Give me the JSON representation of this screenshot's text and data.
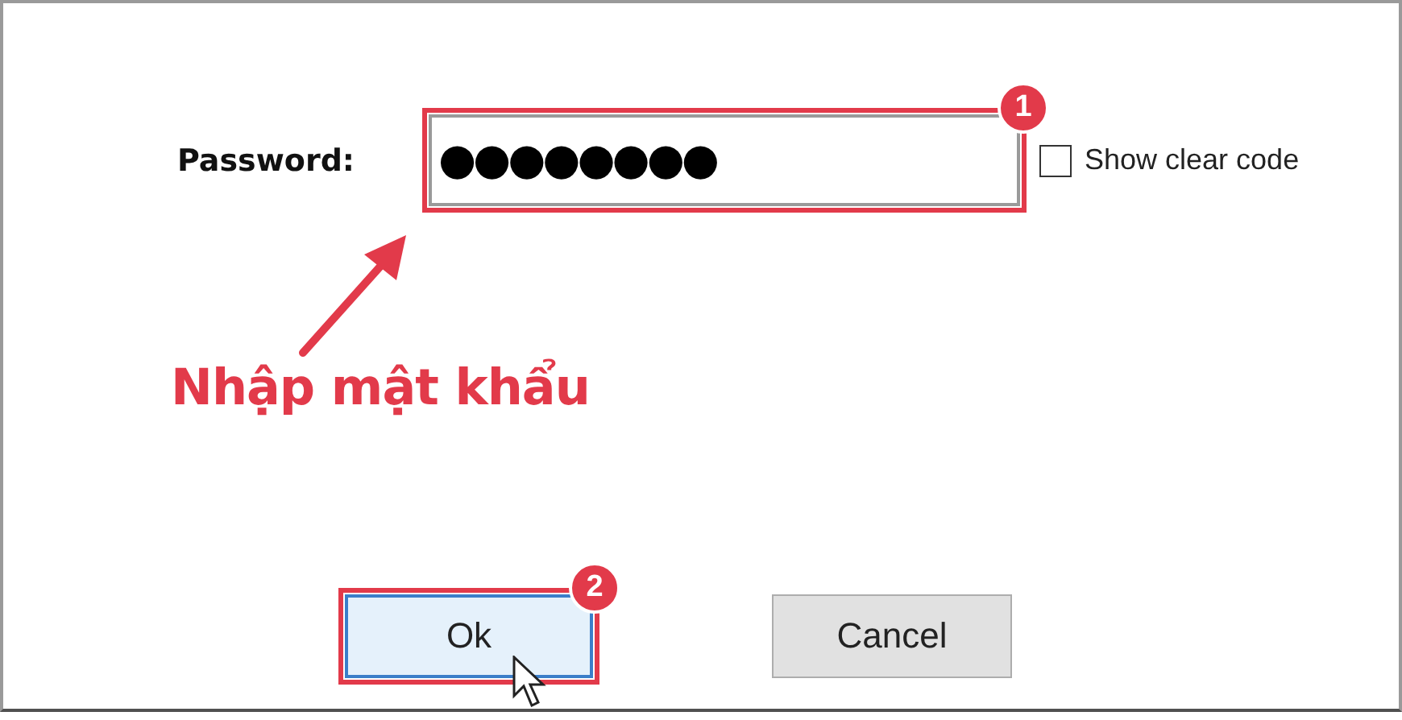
{
  "dialog": {
    "password": {
      "label": "Password:",
      "value": "●●●●●●●●",
      "highlighted": true,
      "badge": "1"
    },
    "show_clear_code": {
      "label": "Show clear code",
      "checked": false
    },
    "annotation": {
      "text": "Nhập mật khẩu"
    },
    "buttons": [
      {
        "label": "Ok",
        "kind": "primary",
        "highlighted": true,
        "badge": "2"
      },
      {
        "label": "Cancel",
        "kind": "default",
        "highlighted": false
      }
    ]
  }
}
